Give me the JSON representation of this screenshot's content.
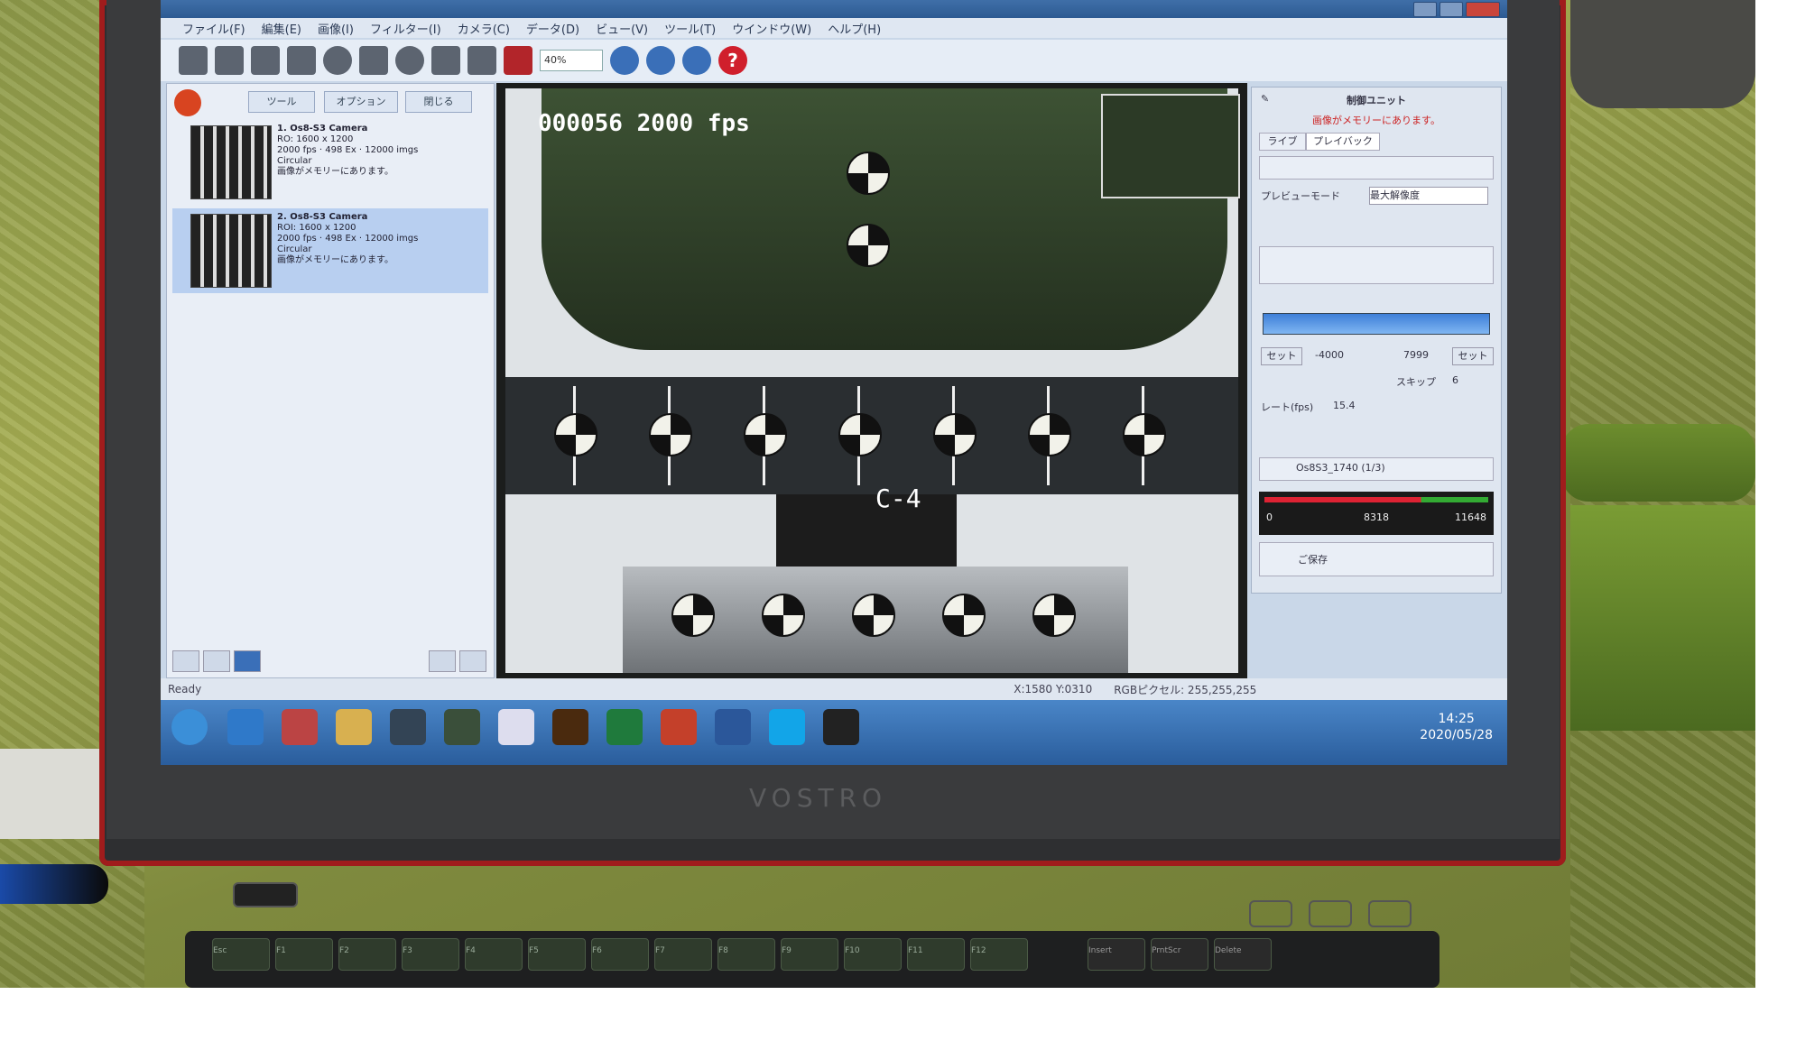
{
  "window": {
    "menu": [
      "ファイル(F)",
      "編集(E)",
      "画像(I)",
      "フィルター(I)",
      "カメラ(C)",
      "データ(D)",
      "ビュー(V)",
      "ツール(T)",
      "ウインドウ(W)",
      "ヘルプ(H)"
    ],
    "zoom": "40%",
    "help_icon": "?"
  },
  "left_panel": {
    "buttons": [
      "ツール",
      "オプション",
      "閉じる"
    ],
    "cameras": [
      {
        "title": "1. Os8-S3 Camera",
        "lines": [
          "RO: 1600 x 1200",
          "2000 fps · 498 Ex · 12000 imgs",
          "Circular",
          "画像がメモリーにあります。"
        ]
      },
      {
        "title": "2. Os8-S3 Camera",
        "lines": [
          "ROI: 1600 x 1200",
          "2000 fps · 498 Ex · 12000 imgs",
          "Circular",
          "画像がメモリーにあります。"
        ]
      }
    ]
  },
  "video": {
    "overlay": "000056  2000 fps",
    "marker": "C-4"
  },
  "right_panel": {
    "header": "制御ユニット",
    "notice": "画像がメモリーにあります。",
    "tabs": [
      "ライブ",
      "プレイバック"
    ],
    "preview_mode": "プレビューモード",
    "preview_value": "最大解像度",
    "range": {
      "start": "-4000",
      "end": "7999"
    },
    "set": "セット",
    "skip": "スキップ",
    "skip_value": "6",
    "rate_label": "レート(fps)",
    "rate_value": "15.4",
    "file": "Os8S3_1740 (1/3)",
    "meter": {
      "low": "0",
      "mid": "8318",
      "high": "11648"
    },
    "save": "ご保存"
  },
  "status": {
    "ready": "Ready",
    "coords": "X:1580  Y:0310",
    "rgb": "RGBピクセル: 255,255,255"
  },
  "taskbar": {
    "time": "14:25",
    "date": "2020/05/28"
  },
  "laptop": {
    "brand": "VOSTRO",
    "keys": [
      "Esc",
      "F1",
      "F2",
      "F3",
      "F4",
      "F5",
      "F6",
      "F7",
      "F8",
      "F9",
      "F10",
      "F11",
      "F12",
      "Insert",
      "PrntScr",
      "Delete"
    ]
  }
}
